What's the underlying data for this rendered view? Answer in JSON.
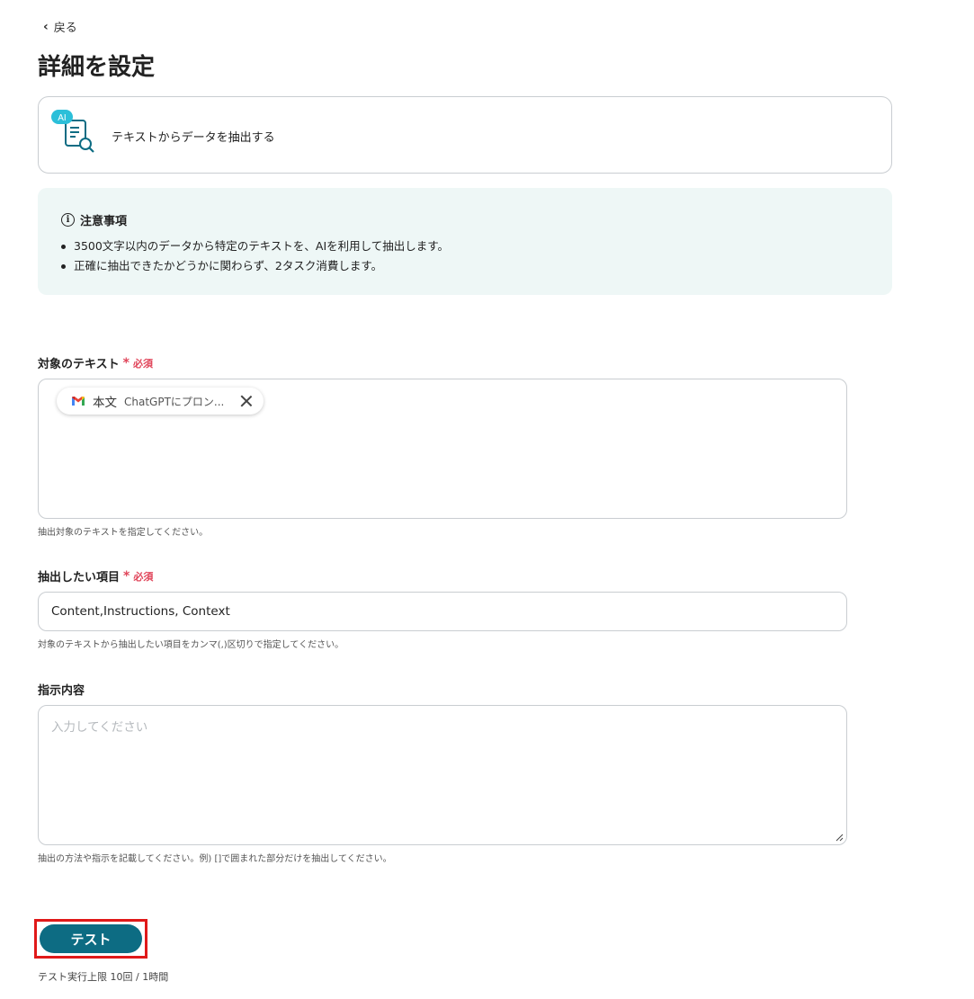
{
  "nav": {
    "back_label": "戻る"
  },
  "page": {
    "title": "詳細を設定"
  },
  "app_card": {
    "label": "テキストからデータを抽出する",
    "ai_badge": "AI"
  },
  "notice": {
    "title": "注意事項",
    "items": [
      "3500文字以内のデータから特定のテキストを、AIを利用して抽出します。",
      "正確に抽出できたかどうかに関わらず、2タスク消費します。"
    ]
  },
  "fields": {
    "target_text": {
      "label": "対象のテキスト",
      "required": "必須",
      "chip": {
        "name": "本文",
        "sub": "ChatGPTにプロン..."
      },
      "hint": "抽出対象のテキストを指定してください。"
    },
    "extract_items": {
      "label": "抽出したい項目",
      "required": "必須",
      "value": "Content,Instructions, Context",
      "hint": "対象のテキストから抽出したい項目をカンマ(,)区切りで指定してください。"
    },
    "instructions": {
      "label": "指示内容",
      "placeholder": "入力してください",
      "hint": "抽出の方法や指示を記載してください。例) []で囲まれた部分だけを抽出してください。"
    }
  },
  "test": {
    "button_label": "テスト",
    "limit_note": "テスト実行上限 10回 / 1時間"
  },
  "colors": {
    "accent": "#0d6c83",
    "required": "#e0455a",
    "notice_bg": "#eef7f6",
    "ai_badge": "#2bbfd9",
    "highlight": "#e01919"
  }
}
